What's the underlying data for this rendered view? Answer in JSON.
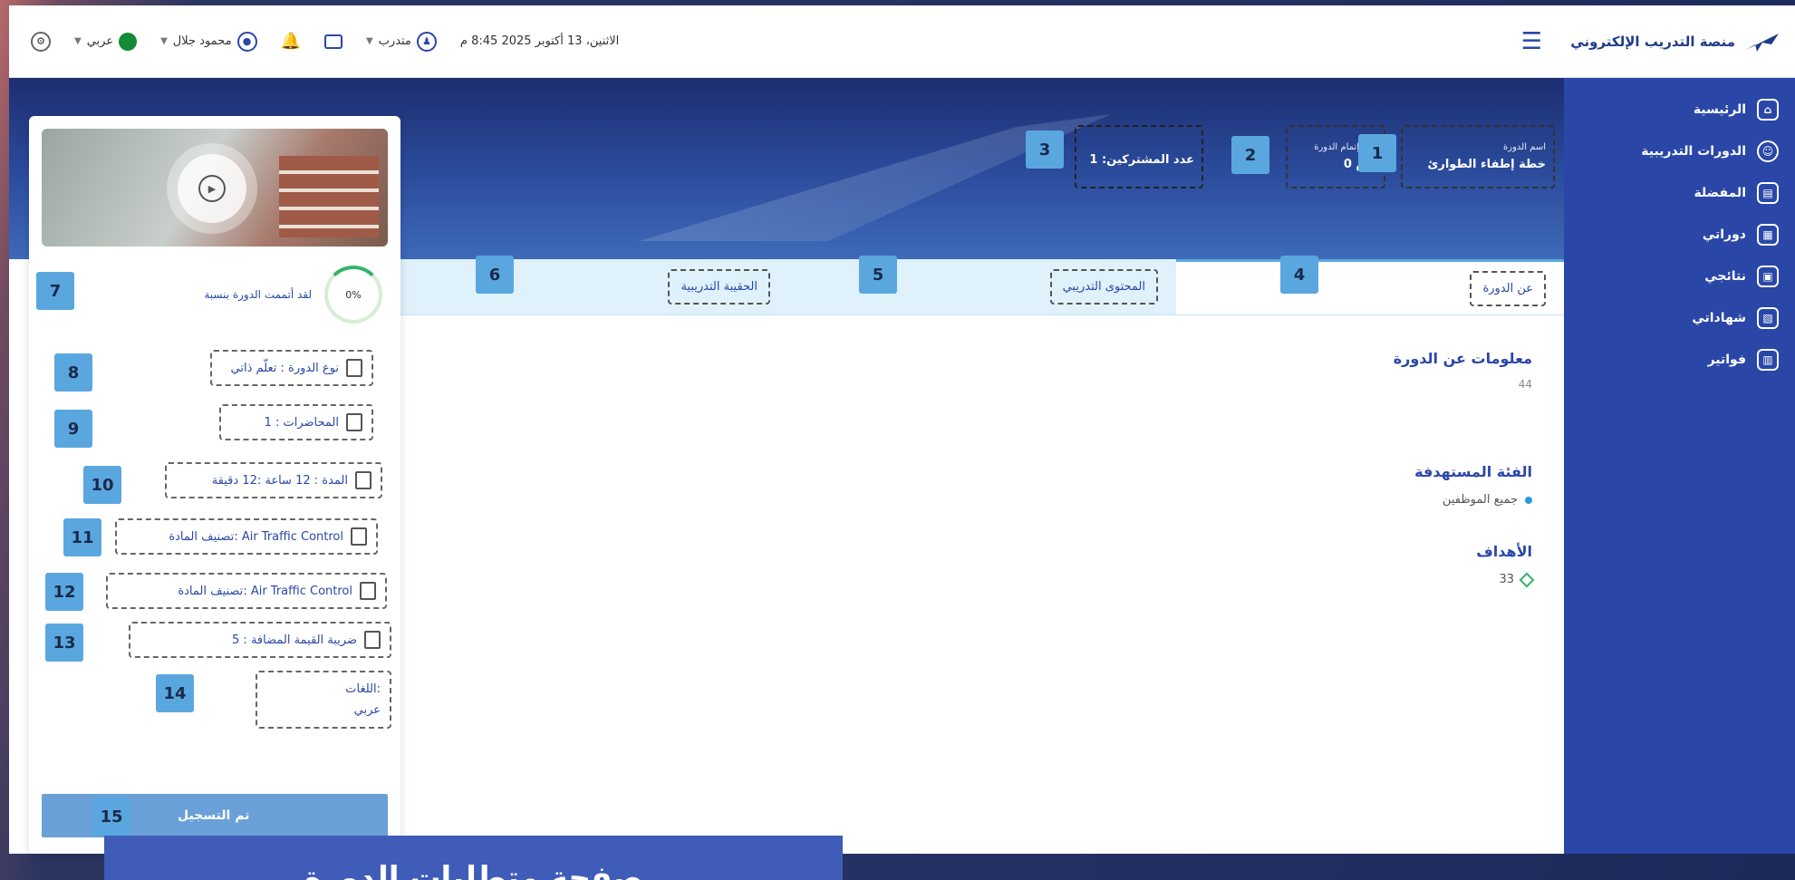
{
  "sidebar": {
    "brand": "منصة التدريب الإلكتروني",
    "items": [
      {
        "label": "الرئيسية",
        "icon": "home-icon"
      },
      {
        "label": "الدورات التدريبية",
        "icon": "courses-icon"
      },
      {
        "label": "المفضلة",
        "icon": "favorites-icon"
      },
      {
        "label": "دوراتي",
        "icon": "my-courses-icon"
      },
      {
        "label": "نتائجي",
        "icon": "results-icon"
      },
      {
        "label": "شهاداتي",
        "icon": "certificates-icon"
      },
      {
        "label": "فواتير",
        "icon": "invoices-icon"
      }
    ]
  },
  "topbar": {
    "language": "عربي",
    "user": "محمود جلال",
    "role": "متدرب",
    "datetime": "الاثنين، 13 أكتوبر 2025  8:45 م"
  },
  "banner": {
    "course_name_label": "اسم الدورة",
    "course_name_value": "خطة إطفاء الطوارئ",
    "duration_label": "مدة إتمام الدورة",
    "duration_value": "0 يوم",
    "subscribers": "عدد المشتركين: 1"
  },
  "card": {
    "progress_label": "لقد أتممت الدورة بنسبة",
    "progress_value": "0%",
    "course_type": "نوع الدورة : تعلّم ذاتي",
    "lectures": "المحاضرات : 1",
    "duration": "المدة : 12 ساعة :12 دقيقة",
    "subject_class_1": "تصنيف المادة: Air Traffic Control",
    "subject_class_2": "تصنيف المادة: Air Traffic Control",
    "vat": "ضريبة القيمة المضافة : 5",
    "languages_label": "اللغات:",
    "languages_value": "عربي",
    "register": "تم التسجيل"
  },
  "tabs": [
    {
      "label": "عن الدورة"
    },
    {
      "label": "المحتوى التدريبي"
    },
    {
      "label": "الحقيبة التدريبية"
    }
  ],
  "content": {
    "about_heading": "معلومات عن الدورة",
    "about_text": "44",
    "target_heading": "الفئة المستهدفة",
    "target_item": "جميع الموظفين",
    "goals_heading": "الأهداف",
    "goals_item": "33"
  },
  "markers": [
    "1",
    "2",
    "3",
    "4",
    "5",
    "6",
    "7",
    "8",
    "9",
    "10",
    "11",
    "12",
    "13",
    "14",
    "15"
  ],
  "caption": "صفحة متطلبات الدورة"
}
